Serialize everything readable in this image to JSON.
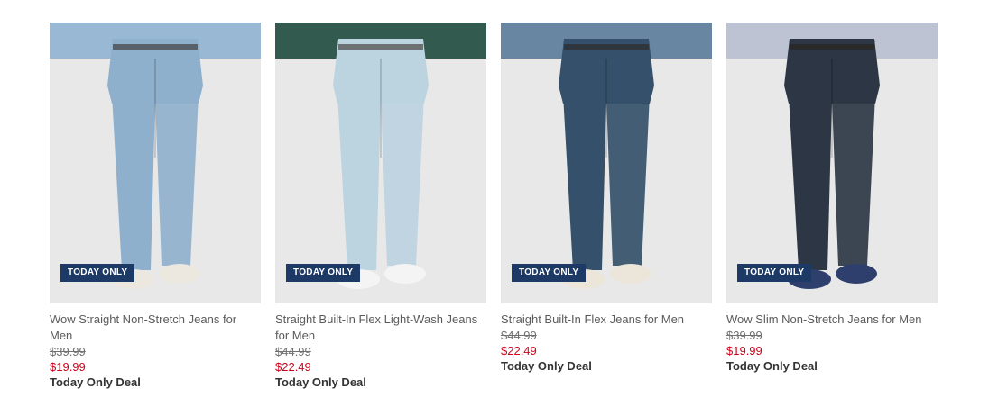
{
  "products": [
    {
      "badge": "TODAY ONLY",
      "name": "Wow Straight Non-Stretch Jeans for Men",
      "original_price": "$39.99",
      "sale_price": "$19.99",
      "deal_label": "Today Only Deal",
      "jeans_color": "#8fb0cc",
      "jacket_color": "#8fb2d0",
      "shoe_color": "#ece8e0"
    },
    {
      "badge": "TODAY ONLY",
      "name": "Straight Built-In Flex Light-Wash Jeans for Men",
      "original_price": "$44.99",
      "sale_price": "$22.49",
      "deal_label": "Today Only Deal",
      "jeans_color": "#bcd3e0",
      "jacket_color": "#1f4a3e",
      "shoe_color": "#f4f4f4"
    },
    {
      "badge": "TODAY ONLY",
      "name": "Straight Built-In Flex Jeans for Men",
      "original_price": "$44.99",
      "sale_price": "$22.49",
      "deal_label": "Today Only Deal",
      "jeans_color": "#34506a",
      "jacket_color": "#5a7a9a",
      "shoe_color": "#ece6da"
    },
    {
      "badge": "TODAY ONLY",
      "name": "Wow Slim Non-Stretch Jeans for Men",
      "original_price": "$39.99",
      "sale_price": "$19.99",
      "deal_label": "Today Only Deal",
      "jeans_color": "#2c3644",
      "jacket_color": "#b8bfd0",
      "shoe_color": "#2e3f6e"
    }
  ]
}
